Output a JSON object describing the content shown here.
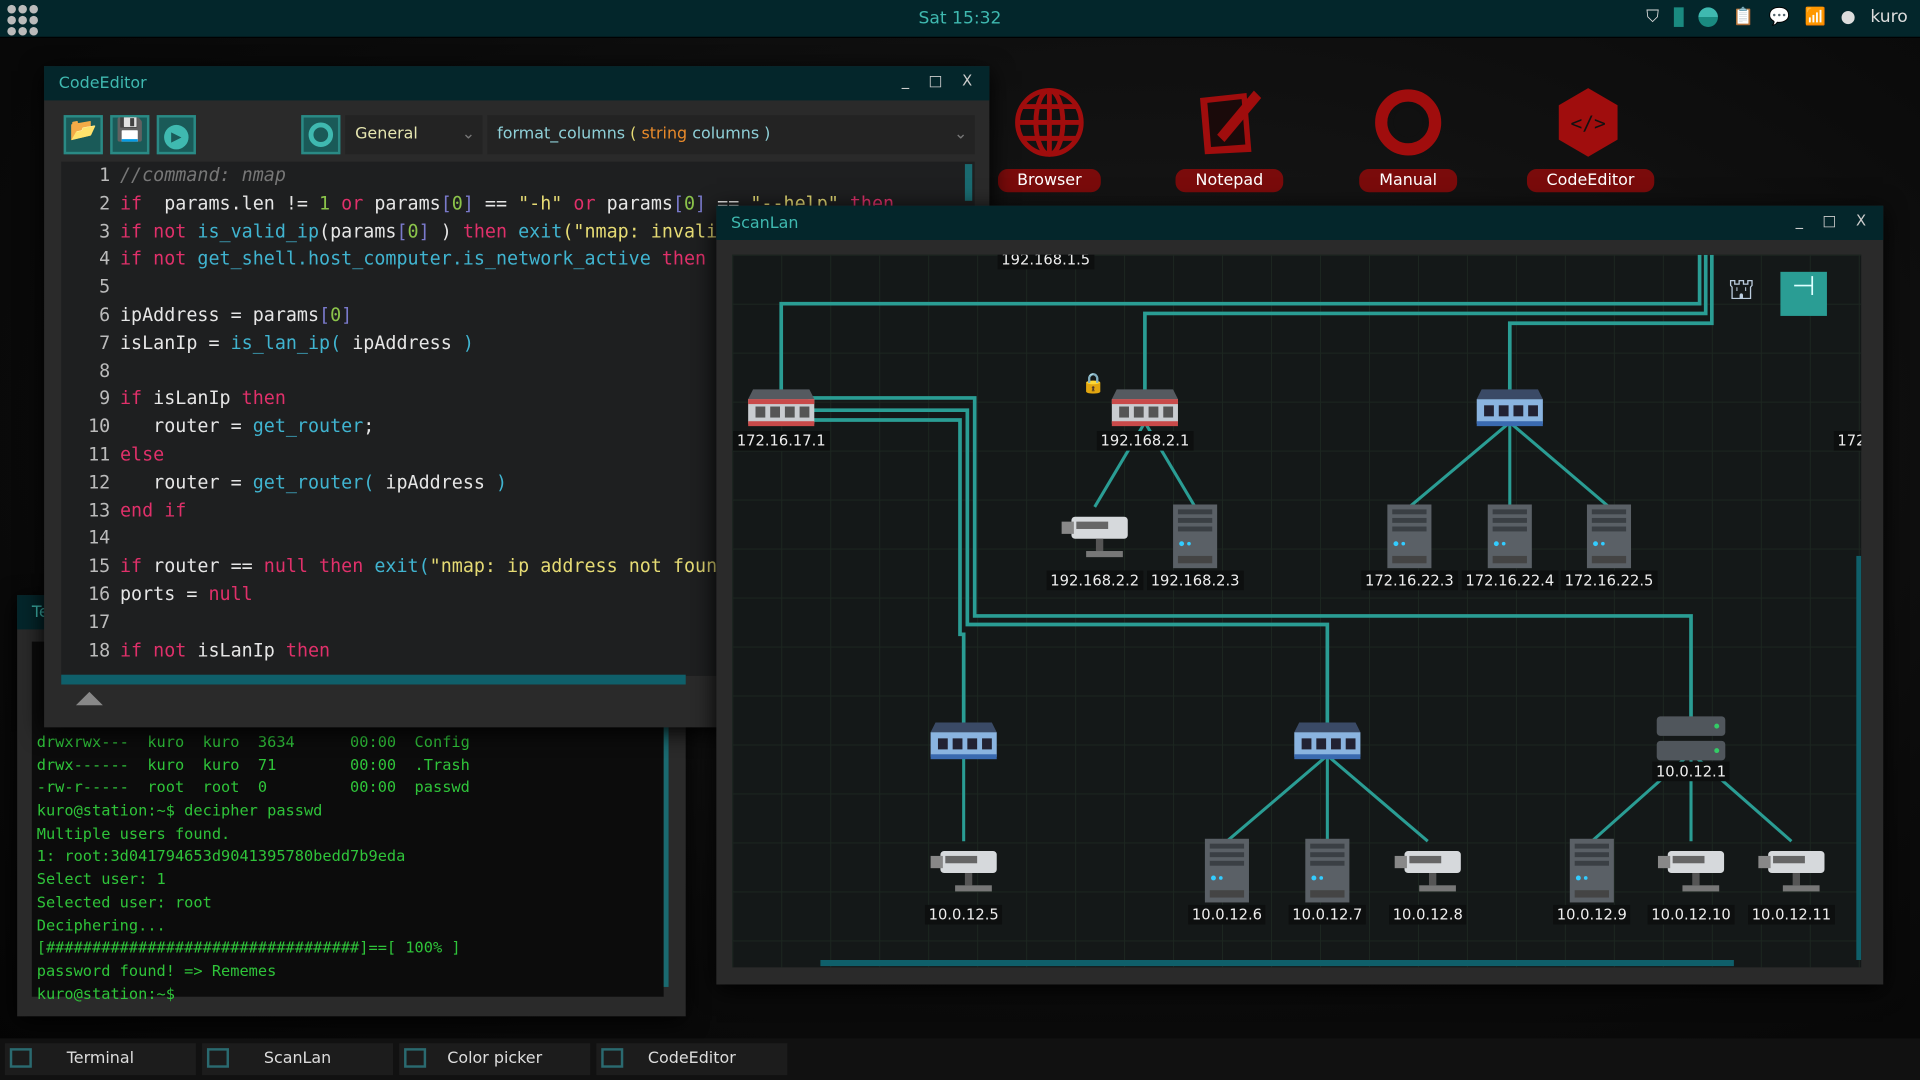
{
  "topbar": {
    "clock": "Sat 15:32",
    "user": "kuro",
    "tray_icons": [
      "shield-icon",
      "battery-icon",
      "globe-icon",
      "clipboard-icon",
      "chat-icon",
      "wifi-icon",
      "user-icon"
    ]
  },
  "desktop_icons": [
    {
      "label": "Browser",
      "icon": "globe-icon"
    },
    {
      "label": "Notepad",
      "icon": "notepad-icon"
    },
    {
      "label": "Manual",
      "icon": "lifebuoy-icon"
    },
    {
      "label": "CodeEditor",
      "icon": "code-icon"
    }
  ],
  "code_editor": {
    "title": "CodeEditor",
    "controls": [
      "_",
      "□",
      "X"
    ],
    "category": "General",
    "function_name": "format_columns",
    "function_sig_open": " ( ",
    "function_param_type": "string",
    "function_param": " columns )",
    "lines": [
      "1",
      "2",
      "3",
      "4",
      "5",
      "6",
      "7",
      "8",
      "9",
      "10",
      "11",
      "12",
      "13",
      "14",
      "15",
      "16",
      "17",
      "18"
    ]
  },
  "terminal": {
    "title": "Te",
    "lines": [
      "drwxrwx---  kuro  kuro  3634      00:00  Config",
      "drwx------  kuro  kuro  71        00:00  .Trash",
      "-rw-r-----  root  root  0         00:00  passwd",
      "kuro@station:~$ decipher passwd",
      "Multiple users found.",
      "1: root:3d041794653d9041395780bedd7b9eda",
      "Select user: 1",
      "Selected user: root",
      "Deciphering...",
      "[##################################]==[ 100% ]",
      "password found! => Rememes",
      "kuro@station:~$"
    ]
  },
  "scanlan": {
    "title": "ScanLan",
    "top_label": "192.168.1.5",
    "partial_label": "172",
    "nodes": [
      {
        "label": "172.16.17.1",
        "type": "router"
      },
      {
        "label": "192.168.2.1",
        "type": "router",
        "locked": true
      },
      {
        "label": "",
        "type": "switch"
      },
      {
        "label": "192.168.2.2",
        "type": "camera"
      },
      {
        "label": "192.168.2.3",
        "type": "computer"
      },
      {
        "label": "172.16.22.3",
        "type": "computer"
      },
      {
        "label": "172.16.22.4",
        "type": "computer"
      },
      {
        "label": "172.16.22.5",
        "type": "computer"
      },
      {
        "label": "",
        "type": "switch"
      },
      {
        "label": "",
        "type": "switch"
      },
      {
        "label": "10.0.12.1",
        "type": "rack"
      },
      {
        "label": "10.0.12.5",
        "type": "camera"
      },
      {
        "label": "10.0.12.6",
        "type": "computer"
      },
      {
        "label": "10.0.12.7",
        "type": "computer"
      },
      {
        "label": "10.0.12.8",
        "type": "camera"
      },
      {
        "label": "10.0.12.9",
        "type": "computer"
      },
      {
        "label": "10.0.12.10",
        "type": "camera"
      },
      {
        "label": "10.0.12.11",
        "type": "camera"
      }
    ]
  },
  "taskbar": [
    {
      "label": "Terminal"
    },
    {
      "label": "ScanLan"
    },
    {
      "label": "Color picker"
    },
    {
      "label": "CodeEditor"
    }
  ],
  "colors": {
    "accent": "#3fb9b0",
    "topbar": "#03262b",
    "desktop_red": "#a00d0d",
    "link": "#2a9d94"
  }
}
